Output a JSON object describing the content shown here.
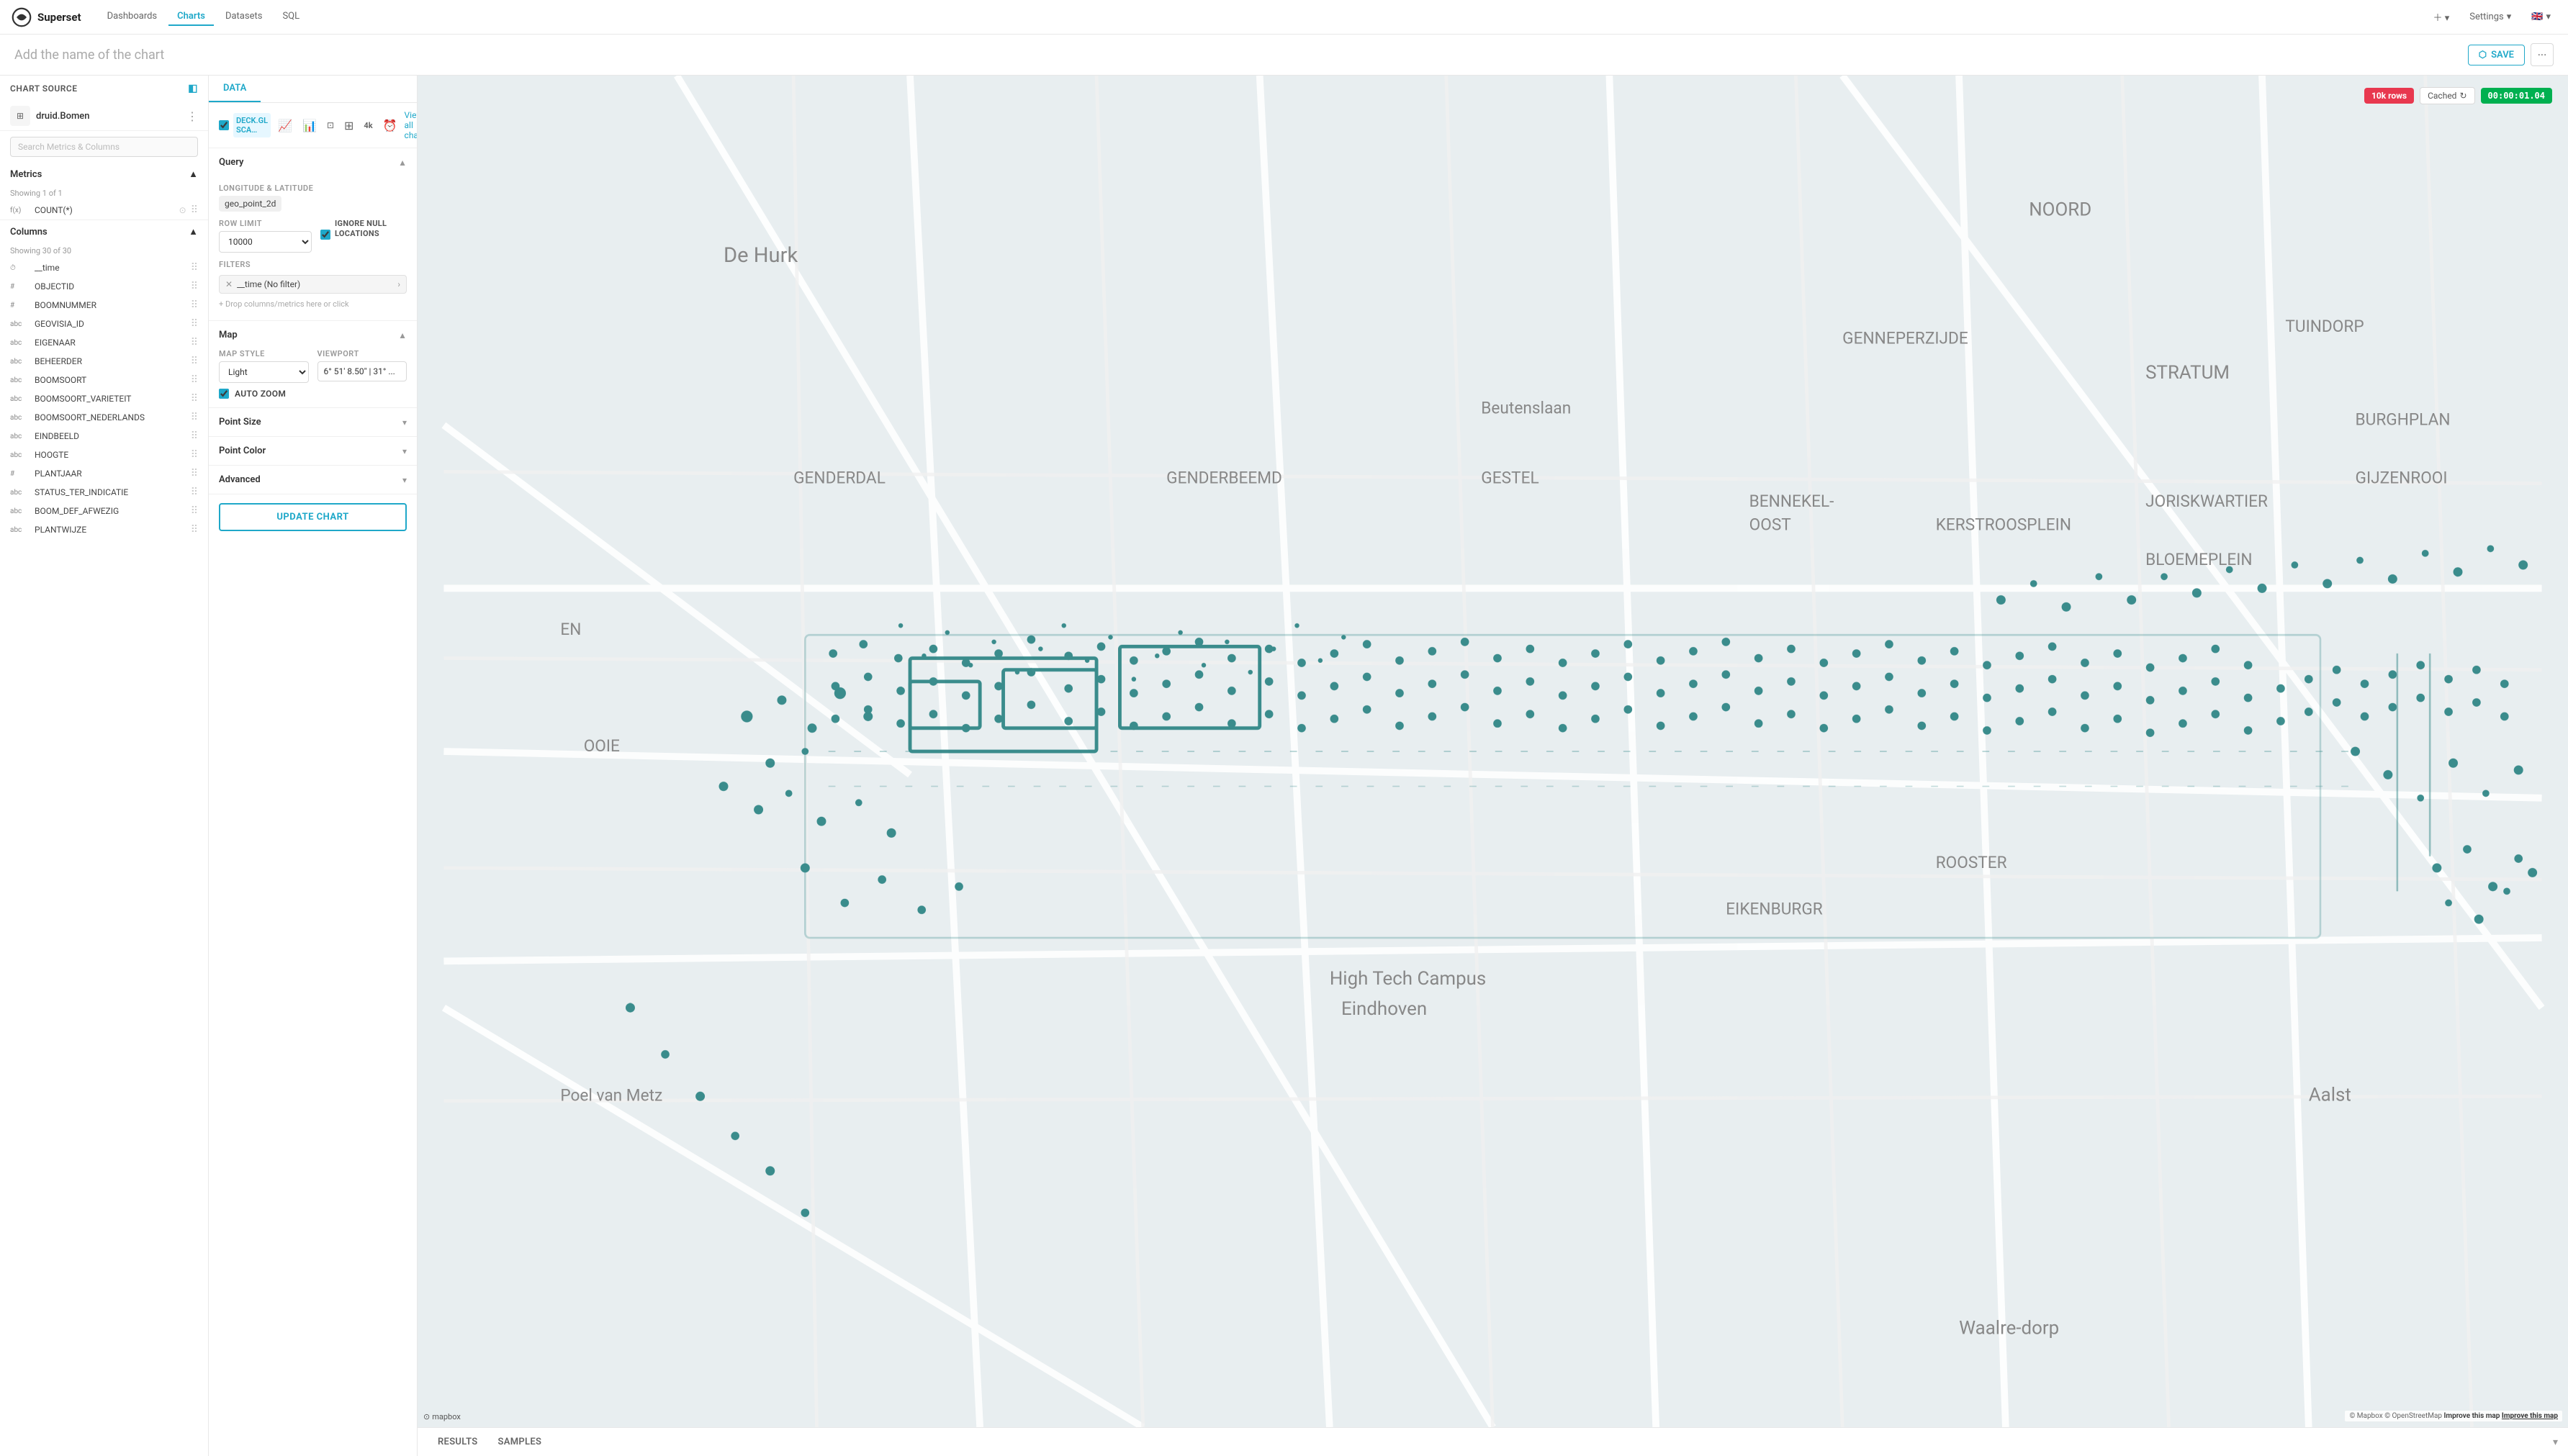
{
  "app": {
    "logo_text": "Superset"
  },
  "topnav": {
    "links": [
      {
        "label": "Dashboards",
        "active": false
      },
      {
        "label": "Charts",
        "active": true
      },
      {
        "label": "Datasets",
        "active": false
      },
      {
        "label": "SQL",
        "active": false
      }
    ],
    "right": {
      "add_label": "+",
      "settings_label": "Settings",
      "lang_label": "🇬🇧"
    }
  },
  "page": {
    "title": "Add the name of the chart",
    "save_label": "SAVE"
  },
  "chart_source": {
    "label": "Chart Source",
    "datasource": "druid.Bomen"
  },
  "search": {
    "placeholder": "Search Metrics & Columns"
  },
  "metrics": {
    "section_label": "Metrics",
    "showing": "Showing 1 of 1",
    "items": [
      {
        "type": "f(x)",
        "name": "COUNT(*)"
      }
    ]
  },
  "columns": {
    "section_label": "Columns",
    "showing": "Showing 30 of 30",
    "items": [
      {
        "type": "⏱",
        "name": "__time"
      },
      {
        "type": "#",
        "name": "OBJECTID"
      },
      {
        "type": "#",
        "name": "BOOMNUMMER"
      },
      {
        "type": "abc",
        "name": "GEOVISIA_ID"
      },
      {
        "type": "abc",
        "name": "EIGENAAR"
      },
      {
        "type": "abc",
        "name": "BEHEERDER"
      },
      {
        "type": "abc",
        "name": "BOOMSOORT"
      },
      {
        "type": "abc",
        "name": "BOOMSOORT_VARIETEIT"
      },
      {
        "type": "abc",
        "name": "BOOMSOORT_NEDERLANDS"
      },
      {
        "type": "abc",
        "name": "EINDBEELD"
      },
      {
        "type": "abc",
        "name": "HOOGTE"
      },
      {
        "type": "#",
        "name": "PLANTJAAR"
      },
      {
        "type": "abc",
        "name": "STATUS_TER_INDICATIE"
      },
      {
        "type": "abc",
        "name": "BOOM_DEF_AFWEZIG"
      },
      {
        "type": "abc",
        "name": "PLANTWIJZE"
      }
    ]
  },
  "data_panel": {
    "tabs": [
      {
        "label": "DATA",
        "active": true
      }
    ],
    "chart_types": [
      "checkbox",
      "line",
      "bar",
      "scatter",
      "table",
      "4k",
      "clock"
    ],
    "view_all_label": "View all charts",
    "query_section": {
      "label": "Query",
      "lon_lat_label": "LONGITUDE & LATITUDE",
      "lon_lat_value": "geo_point_2d",
      "row_limit_label": "ROW LIMIT",
      "row_limit_value": "10000",
      "ignore_null_label": "IGNORE NULL LOCATIONS",
      "ignore_null_checked": true,
      "filters_label": "FILTERS",
      "filter_item": "__time (No filter)",
      "add_filter_label": "+ Drop columns/metrics here or click"
    },
    "map_section": {
      "label": "Map",
      "map_style_label": "MAP STYLE",
      "map_style_value": "Light",
      "viewport_label": "VIEWPORT",
      "viewport_value": "6° 51' 8.50\" | 31° ...",
      "auto_zoom_label": "AUTO ZOOM",
      "auto_zoom_checked": true
    },
    "point_size_section": {
      "label": "Point Size"
    },
    "point_color_section": {
      "label": "Point Color"
    },
    "advanced_section": {
      "label": "Advanced"
    },
    "update_btn": "UPDATE CHART"
  },
  "map": {
    "rows_badge": "10k rows",
    "cached_label": "Cached",
    "timer_label": "00:00:01.04",
    "attribution": "© Mapbox © OpenStreetMap",
    "improve_label": "Improve this map"
  },
  "bottom_tabs": [
    {
      "label": "RESULTS",
      "active": false
    },
    {
      "label": "SAMPLES",
      "active": false
    }
  ]
}
